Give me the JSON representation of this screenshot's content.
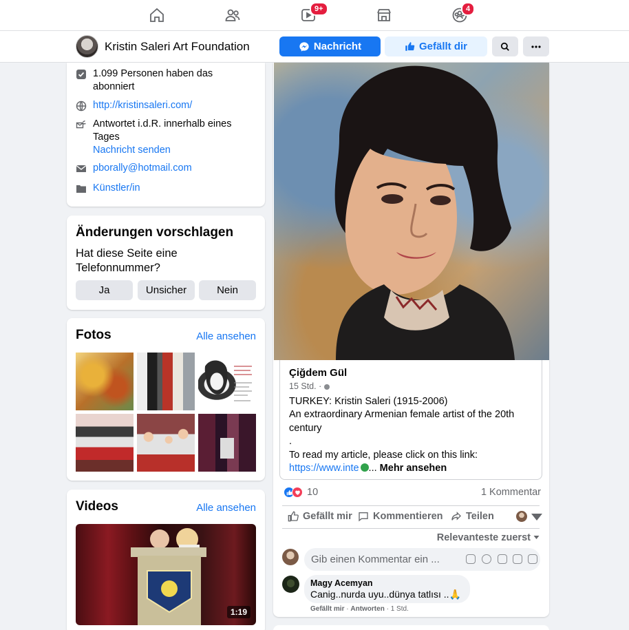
{
  "nav": {
    "badges": {
      "watch": "9+",
      "groups": "4"
    },
    "icons": [
      "home-icon",
      "friends-icon",
      "watch-icon",
      "marketplace-icon",
      "groups-icon"
    ]
  },
  "page": {
    "title": "Kristin Saleri Art Foundation",
    "message_label": "Nachricht",
    "like_label": "Gefällt dir"
  },
  "about": {
    "followers": "1.099 Personen haben das abonniert",
    "website": "http://kristinsaleri.com/",
    "response": "Antwortet i.d.R. innerhalb eines Tages",
    "send_message": "Nachricht senden",
    "email": "pborally@hotmail.com",
    "category": "Künstler/in"
  },
  "suggest": {
    "title": "Änderungen vorschlagen",
    "question": "Hat diese Seite eine Telefonnummer?",
    "yes": "Ja",
    "unsure": "Unsicher",
    "no": "Nein"
  },
  "photos": {
    "title": "Fotos",
    "see_all": "Alle ansehen"
  },
  "videos": {
    "title": "Videos",
    "see_all": "Alle ansehen",
    "duration": "1:19"
  },
  "post": {
    "shared_author": "Çiğdem Gül",
    "shared_time": "15 Std. ·",
    "text_line1": "TURKEY: Kristin Saleri (1915-2006)",
    "text_line2": "An extraordinary Armenian female artist of the 20th century",
    "text_line3": ".",
    "text_line4": "To read my article, please click on this link:",
    "link": "https://www.inte",
    "ellipsis": "...",
    "see_more": "Mehr ansehen",
    "reactions": "10",
    "comments_count": "1 Kommentar",
    "like_action": "Gefällt mir",
    "comment_action": "Kommentieren",
    "share_action": "Teilen",
    "sort": "Relevanteste zuerst",
    "comment_placeholder": "Gib einen Kommentar ein ...",
    "comment": {
      "author": "Magy Acemyan",
      "text": "Canig..nurda uyu..dünya tatlısı ..🙏",
      "like": "Gefällt mir",
      "reply": "Antworten",
      "time": "1 Std."
    }
  },
  "colors": {
    "brand": "#1877f2",
    "badge": "#e41e3f",
    "background": "#f0f2f5"
  }
}
